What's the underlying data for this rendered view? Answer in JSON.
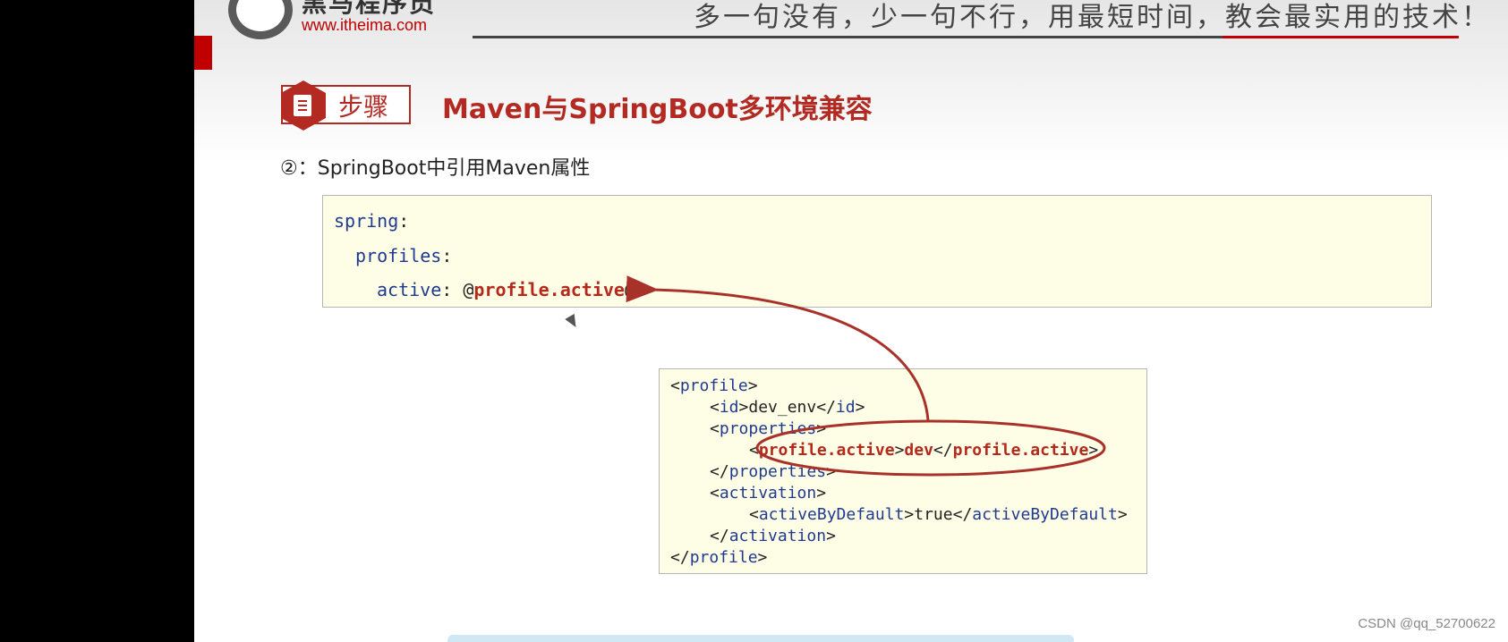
{
  "header": {
    "logo_cn": "黑马程序员",
    "logo_url": "www.itheima.com",
    "slogan": "多一句没有，少一句不行，用最短时间，教会最实用的技术！"
  },
  "step": {
    "label": "步骤",
    "title": "Maven与SpringBoot多环境兼容"
  },
  "subtitle": "②：SpringBoot中引用Maven属性",
  "yaml": {
    "line1_key": "spring",
    "line2_key": "profiles",
    "line3_key": "active",
    "line3_value": "profile.active",
    "at": "@",
    "colon": ":"
  },
  "xml": {
    "profile": "profile",
    "id": "id",
    "id_value": "dev_env",
    "properties": "properties",
    "profile_active": "profile.active",
    "profile_active_value": "dev",
    "activation": "activation",
    "active_by_default": "activeByDefault",
    "active_by_default_value": "true"
  },
  "watermark": "CSDN @qq_52700622",
  "colors": {
    "accent_red": "#b22a22",
    "keyword_blue": "#1f3a8f",
    "code_bg": "#fefee6"
  },
  "icons": [
    "document-icon",
    "cursor-icon",
    "arrow-icon"
  ]
}
